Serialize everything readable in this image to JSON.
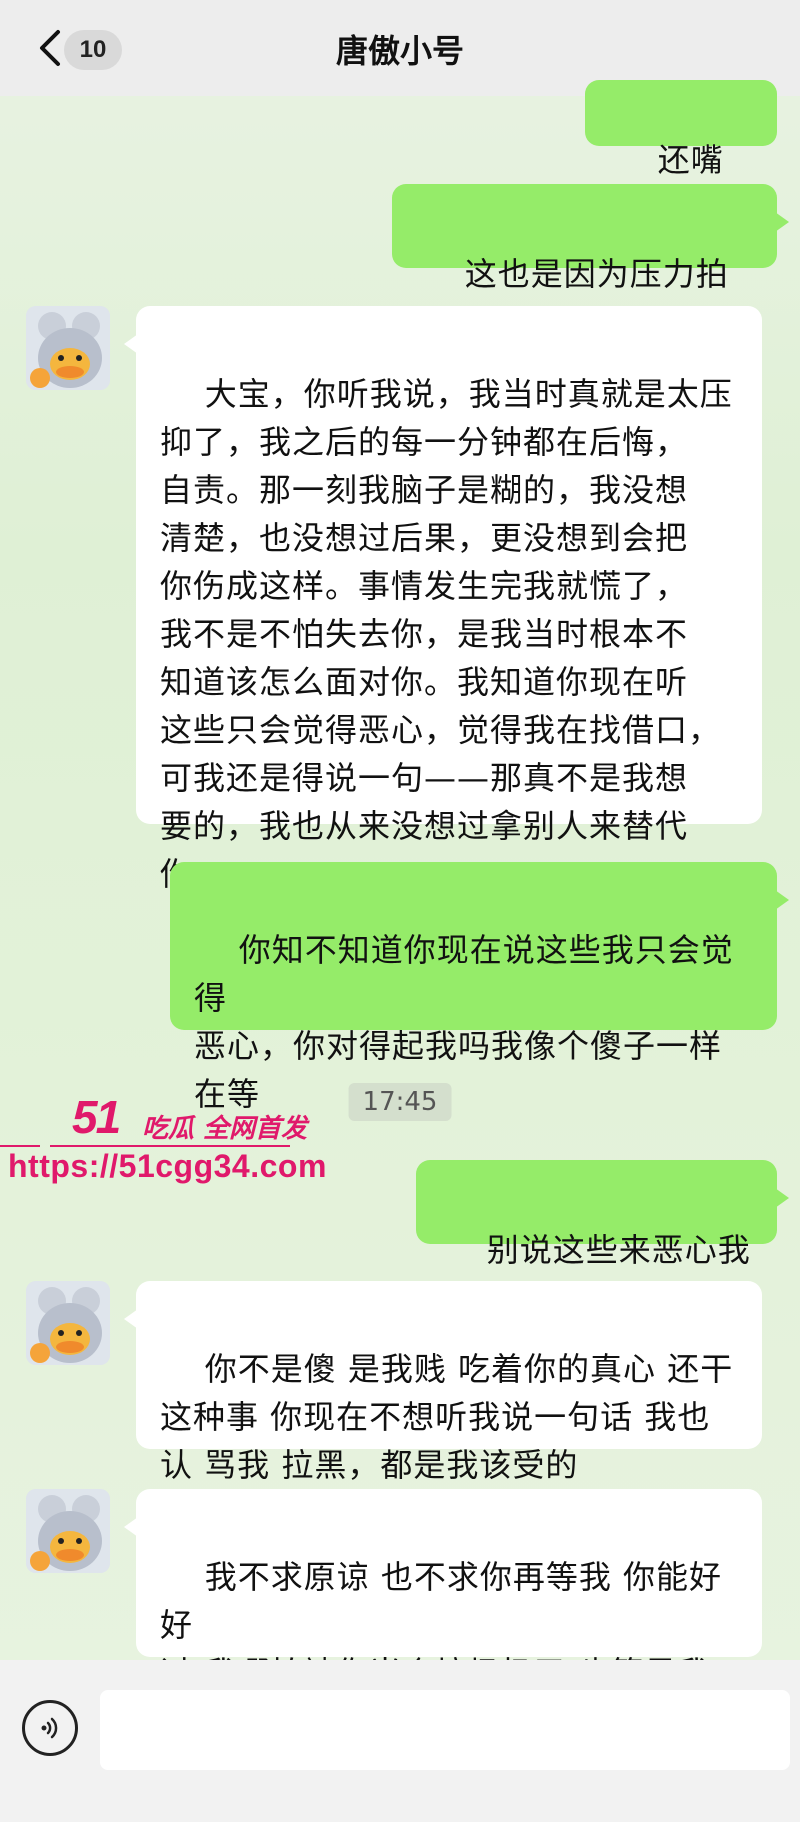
{
  "header": {
    "unread_count": "10",
    "title": "唐傲小号"
  },
  "messages": [
    {
      "side": "out",
      "text": "还嘴硬吗"
    },
    {
      "side": "out",
      "text": "这也是因为压力拍的?"
    },
    {
      "side": "in",
      "text": "大宝，你听我说，我当时真就是太压\n抑了，我之后的每一分钟都在后悔，\n自责。那一刻我脑子是糊的，我没想\n清楚，也没想过后果，更没想到会把\n你伤成这样。事情发生完我就慌了，\n我不是不怕失去你，是我当时根本不\n知道该怎么面对你。我知道你现在听\n这些只会觉得恶心，觉得我在找借口，\n可我还是得说一句——那真不是我想\n要的，我也从来没想过拿别人来替代\n你。"
    },
    {
      "side": "out",
      "text": "你知不知道你现在说这些我只会觉得\n恶心，你对得起我吗我像个傻子一样\n在等"
    },
    {
      "side": "time",
      "text": "17:45"
    },
    {
      "side": "out",
      "text": "别说这些来恶心我了"
    },
    {
      "side": "in",
      "text": "你不是傻 是我贱 吃着你的真心 还干\n这种事 你现在不想听我说一句话 我也\n认 骂我 拉黑，都是我该受的"
    },
    {
      "side": "in",
      "text": "我不求原谅 也不求你再等我 你能好好\n过 我哪怕被你当个垃圾扔了 也算是我\n该付的代价"
    }
  ],
  "watermark": {
    "brand_big": "51",
    "brand_small": "吃瓜 全网首发",
    "url": "https://51cgg34.com"
  },
  "icons": {
    "back": "chevron-left-icon",
    "voice": "voice-icon",
    "avatar": "duck-avatar"
  },
  "colors": {
    "outgoing_bubble": "#95ec69",
    "incoming_bubble": "#ffffff",
    "watermark": "#e0196b"
  }
}
